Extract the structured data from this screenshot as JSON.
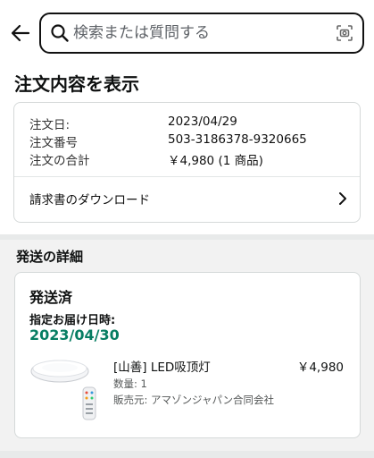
{
  "header": {
    "search_placeholder": "検索または質問する"
  },
  "page": {
    "title": "注文内容を表示"
  },
  "order_summary": {
    "date_label": "注文日:",
    "date_value": "2023/04/29",
    "number_label": "注文番号",
    "number_value": "503-3186378-9320665",
    "total_label": "注文の合計",
    "total_value": "￥4,980 (1 商品)",
    "invoice_label": "請求書のダウンロード"
  },
  "shipping": {
    "section_title": "発送の詳細",
    "status": "発送済",
    "delivery_label": "指定お届け日時:",
    "delivery_date": "2023/04/30",
    "delivery_date_color": "#067d62",
    "item": {
      "name": "[山善] LED吸顶灯",
      "price": "￥4,980",
      "quantity": "数量: 1",
      "seller": "販売元: アマゾンジャパン合同会社"
    }
  }
}
